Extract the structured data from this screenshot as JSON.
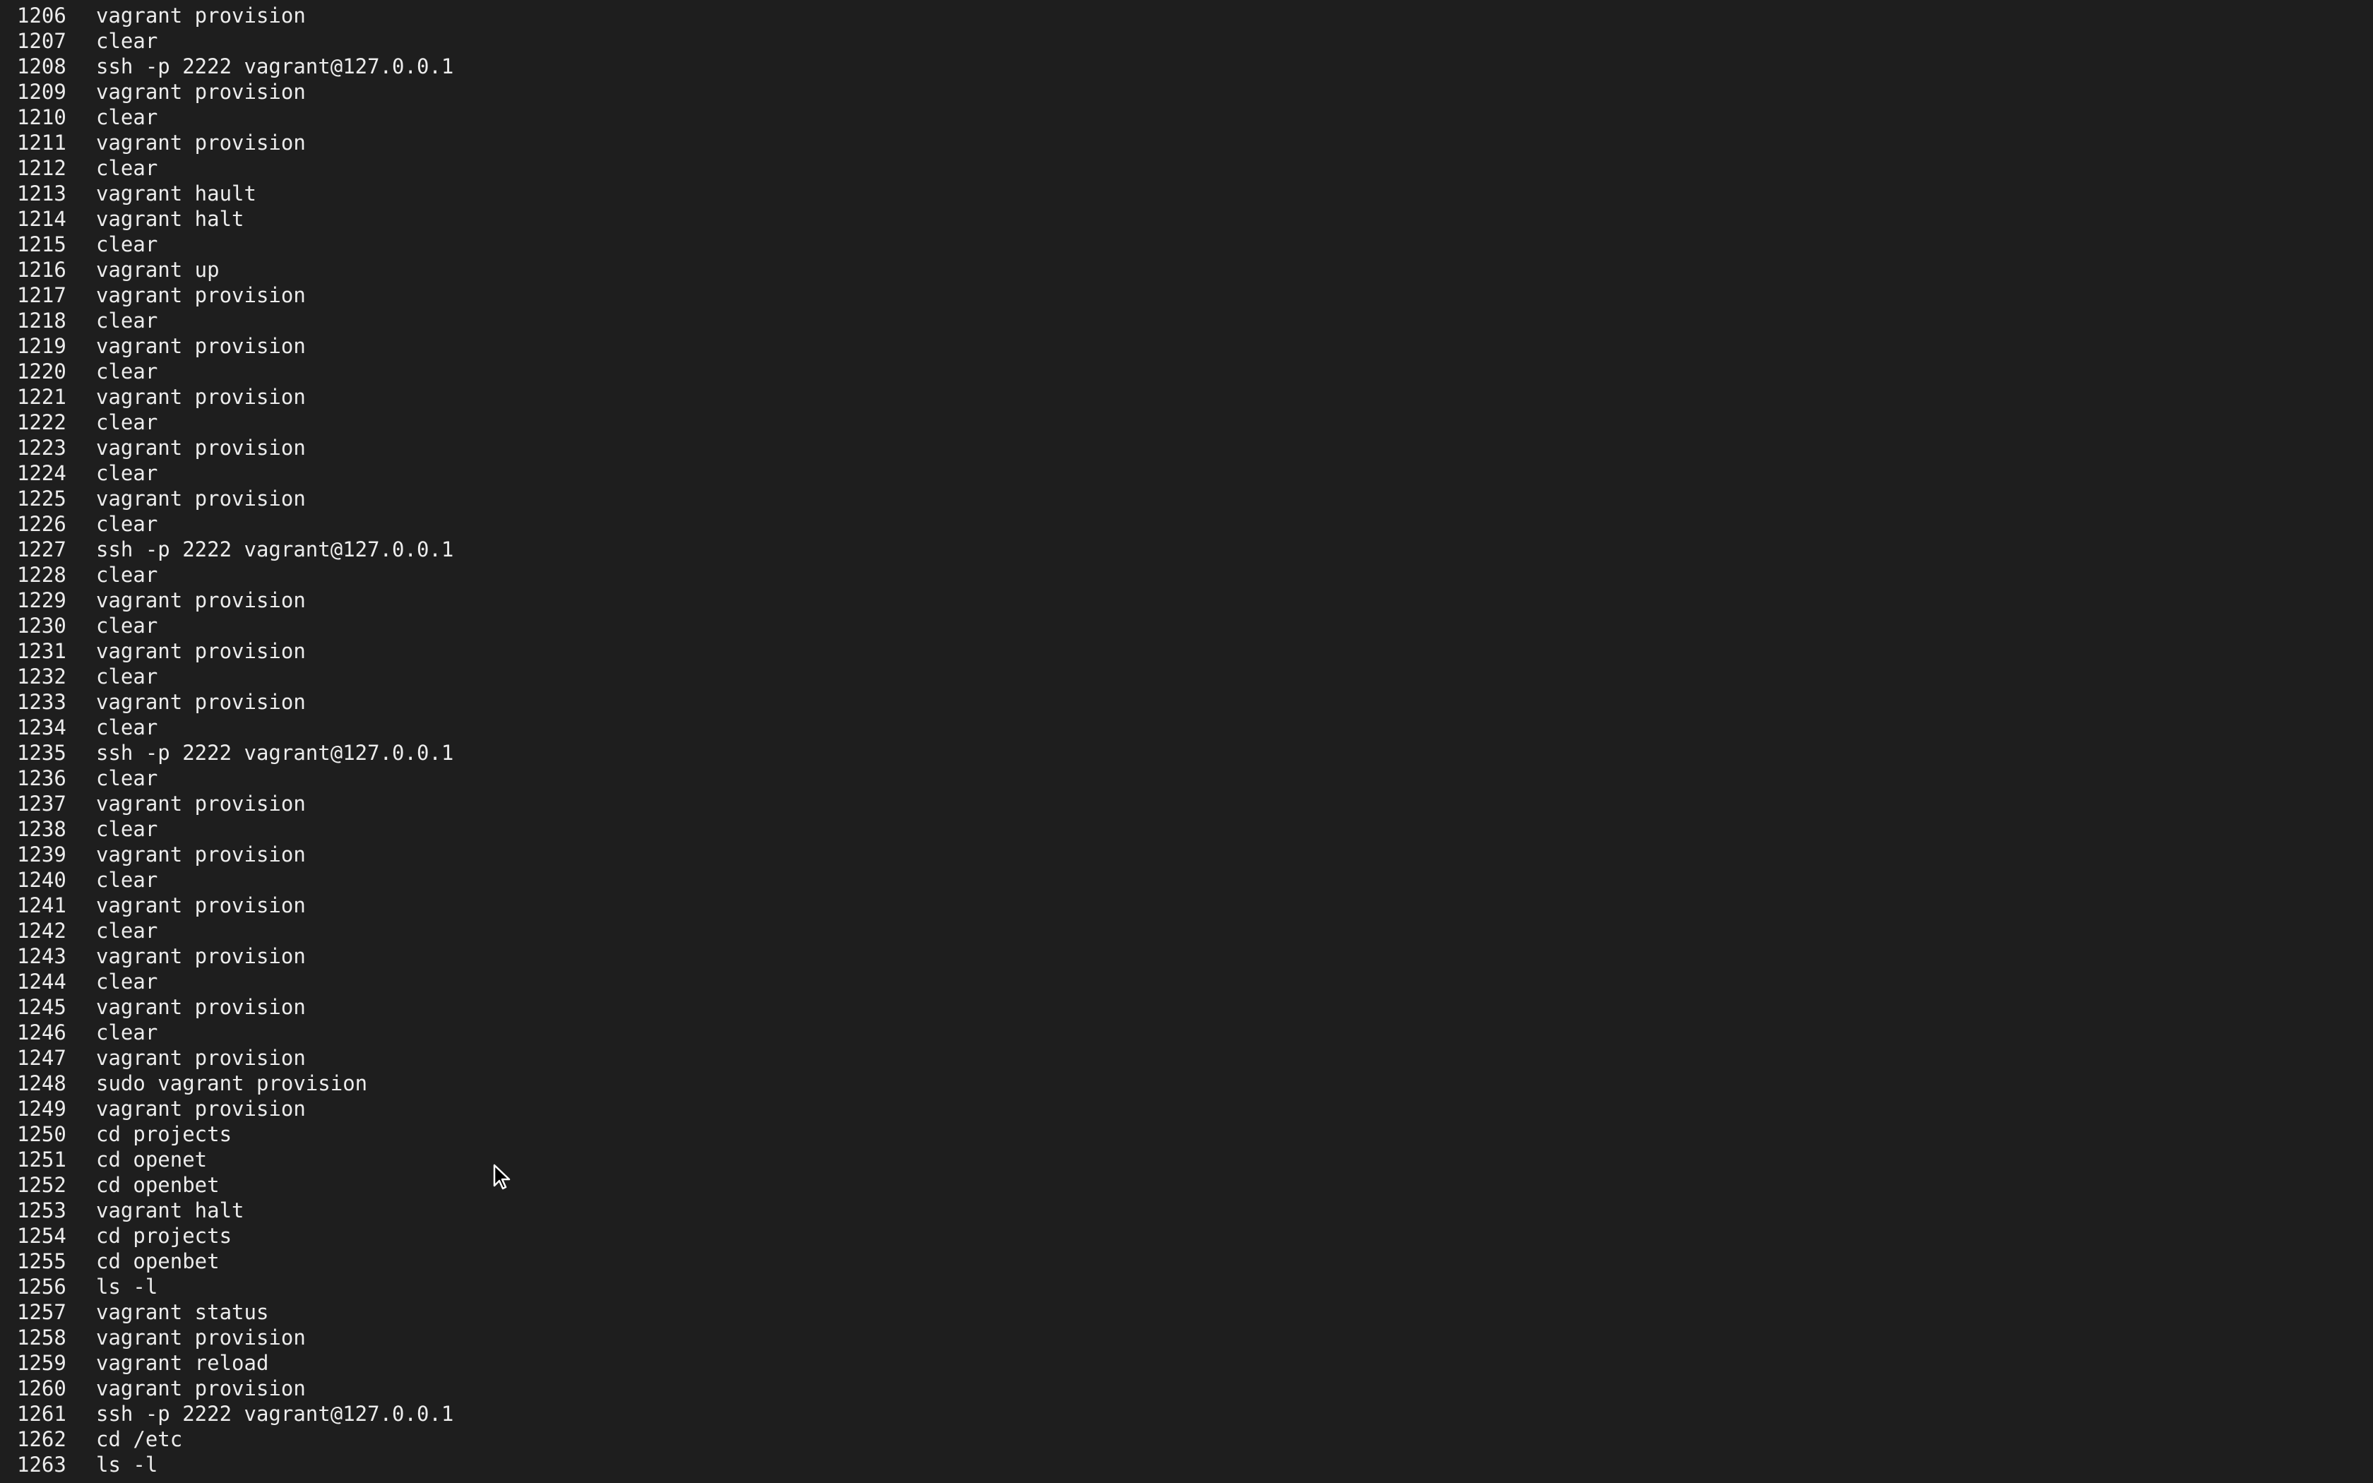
{
  "history": [
    {
      "num": "1206",
      "cmd": "vagrant provision"
    },
    {
      "num": "1207",
      "cmd": "clear"
    },
    {
      "num": "1208",
      "cmd": "ssh -p 2222 vagrant@127.0.0.1"
    },
    {
      "num": "1209",
      "cmd": "vagrant provision"
    },
    {
      "num": "1210",
      "cmd": "clear"
    },
    {
      "num": "1211",
      "cmd": "vagrant provision"
    },
    {
      "num": "1212",
      "cmd": "clear"
    },
    {
      "num": "1213",
      "cmd": "vagrant hault"
    },
    {
      "num": "1214",
      "cmd": "vagrant halt"
    },
    {
      "num": "1215",
      "cmd": "clear"
    },
    {
      "num": "1216",
      "cmd": "vagrant up"
    },
    {
      "num": "1217",
      "cmd": "vagrant provision"
    },
    {
      "num": "1218",
      "cmd": "clear"
    },
    {
      "num": "1219",
      "cmd": "vagrant provision"
    },
    {
      "num": "1220",
      "cmd": "clear"
    },
    {
      "num": "1221",
      "cmd": "vagrant provision"
    },
    {
      "num": "1222",
      "cmd": "clear"
    },
    {
      "num": "1223",
      "cmd": "vagrant provision"
    },
    {
      "num": "1224",
      "cmd": "clear"
    },
    {
      "num": "1225",
      "cmd": "vagrant provision"
    },
    {
      "num": "1226",
      "cmd": "clear"
    },
    {
      "num": "1227",
      "cmd": "ssh -p 2222 vagrant@127.0.0.1"
    },
    {
      "num": "1228",
      "cmd": "clear"
    },
    {
      "num": "1229",
      "cmd": "vagrant provision"
    },
    {
      "num": "1230",
      "cmd": "clear"
    },
    {
      "num": "1231",
      "cmd": "vagrant provision"
    },
    {
      "num": "1232",
      "cmd": "clear"
    },
    {
      "num": "1233",
      "cmd": "vagrant provision"
    },
    {
      "num": "1234",
      "cmd": "clear"
    },
    {
      "num": "1235",
      "cmd": "ssh -p 2222 vagrant@127.0.0.1"
    },
    {
      "num": "1236",
      "cmd": "clear"
    },
    {
      "num": "1237",
      "cmd": "vagrant provision"
    },
    {
      "num": "1238",
      "cmd": "clear"
    },
    {
      "num": "1239",
      "cmd": "vagrant provision"
    },
    {
      "num": "1240",
      "cmd": "clear"
    },
    {
      "num": "1241",
      "cmd": "vagrant provision"
    },
    {
      "num": "1242",
      "cmd": "clear"
    },
    {
      "num": "1243",
      "cmd": "vagrant provision"
    },
    {
      "num": "1244",
      "cmd": "clear"
    },
    {
      "num": "1245",
      "cmd": "vagrant provision"
    },
    {
      "num": "1246",
      "cmd": "clear"
    },
    {
      "num": "1247",
      "cmd": "vagrant provision"
    },
    {
      "num": "1248",
      "cmd": "sudo vagrant provision"
    },
    {
      "num": "1249",
      "cmd": "vagrant provision"
    },
    {
      "num": "1250",
      "cmd": "cd projects"
    },
    {
      "num": "1251",
      "cmd": "cd openet"
    },
    {
      "num": "1252",
      "cmd": "cd openbet"
    },
    {
      "num": "1253",
      "cmd": "vagrant halt"
    },
    {
      "num": "1254",
      "cmd": "cd projects"
    },
    {
      "num": "1255",
      "cmd": "cd openbet"
    },
    {
      "num": "1256",
      "cmd": "ls -l"
    },
    {
      "num": "1257",
      "cmd": "vagrant status"
    },
    {
      "num": "1258",
      "cmd": "vagrant provision"
    },
    {
      "num": "1259",
      "cmd": "vagrant reload"
    },
    {
      "num": "1260",
      "cmd": "vagrant provision"
    },
    {
      "num": "1261",
      "cmd": "ssh -p 2222 vagrant@127.0.0.1"
    },
    {
      "num": "1262",
      "cmd": "cd /etc"
    },
    {
      "num": "1263",
      "cmd": "ls -l"
    }
  ],
  "colors": {
    "background": "#1e1e1e",
    "text": "#ececec"
  },
  "cursor": {
    "icon": "mouse-pointer-icon"
  }
}
